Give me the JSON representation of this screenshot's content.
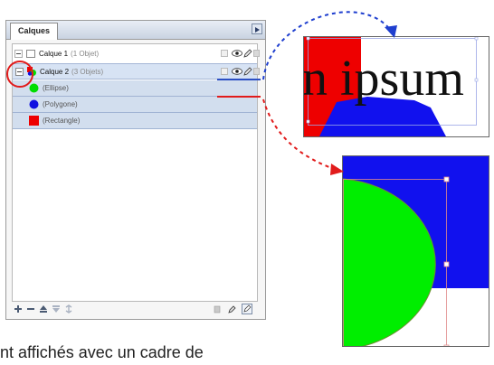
{
  "panel": {
    "tab_label": "Calques",
    "layers": [
      {
        "name": "Calque 1",
        "count": "(1 Objet)"
      },
      {
        "name": "Calque 2",
        "count": "(3 Objets)"
      }
    ],
    "objects": [
      {
        "label": "(Ellipse)",
        "color": "#00dd00",
        "shape": "circle"
      },
      {
        "label": "(Polygone)",
        "color": "#1010e0",
        "shape": "circle"
      },
      {
        "label": "(Rectangle)",
        "color": "#ee0000",
        "shape": "square"
      }
    ],
    "toolbar_icons": [
      "add-layer-icon",
      "remove-layer-icon",
      "move-up-icon",
      "move-down-icon",
      "merge-icon",
      "trash-icon",
      "duplicate-icon",
      "options-icon"
    ]
  },
  "canvas1": {
    "text": "n ipsum"
  },
  "caption": "nt affichés avec un cadre de",
  "colors": {
    "red": "#ee0000",
    "green": "#00ee00",
    "blue": "#1111ee",
    "arrow_blue": "#1f3fcf",
    "arrow_red": "#e11b1b",
    "selection_outline": "#9aa6e6"
  }
}
